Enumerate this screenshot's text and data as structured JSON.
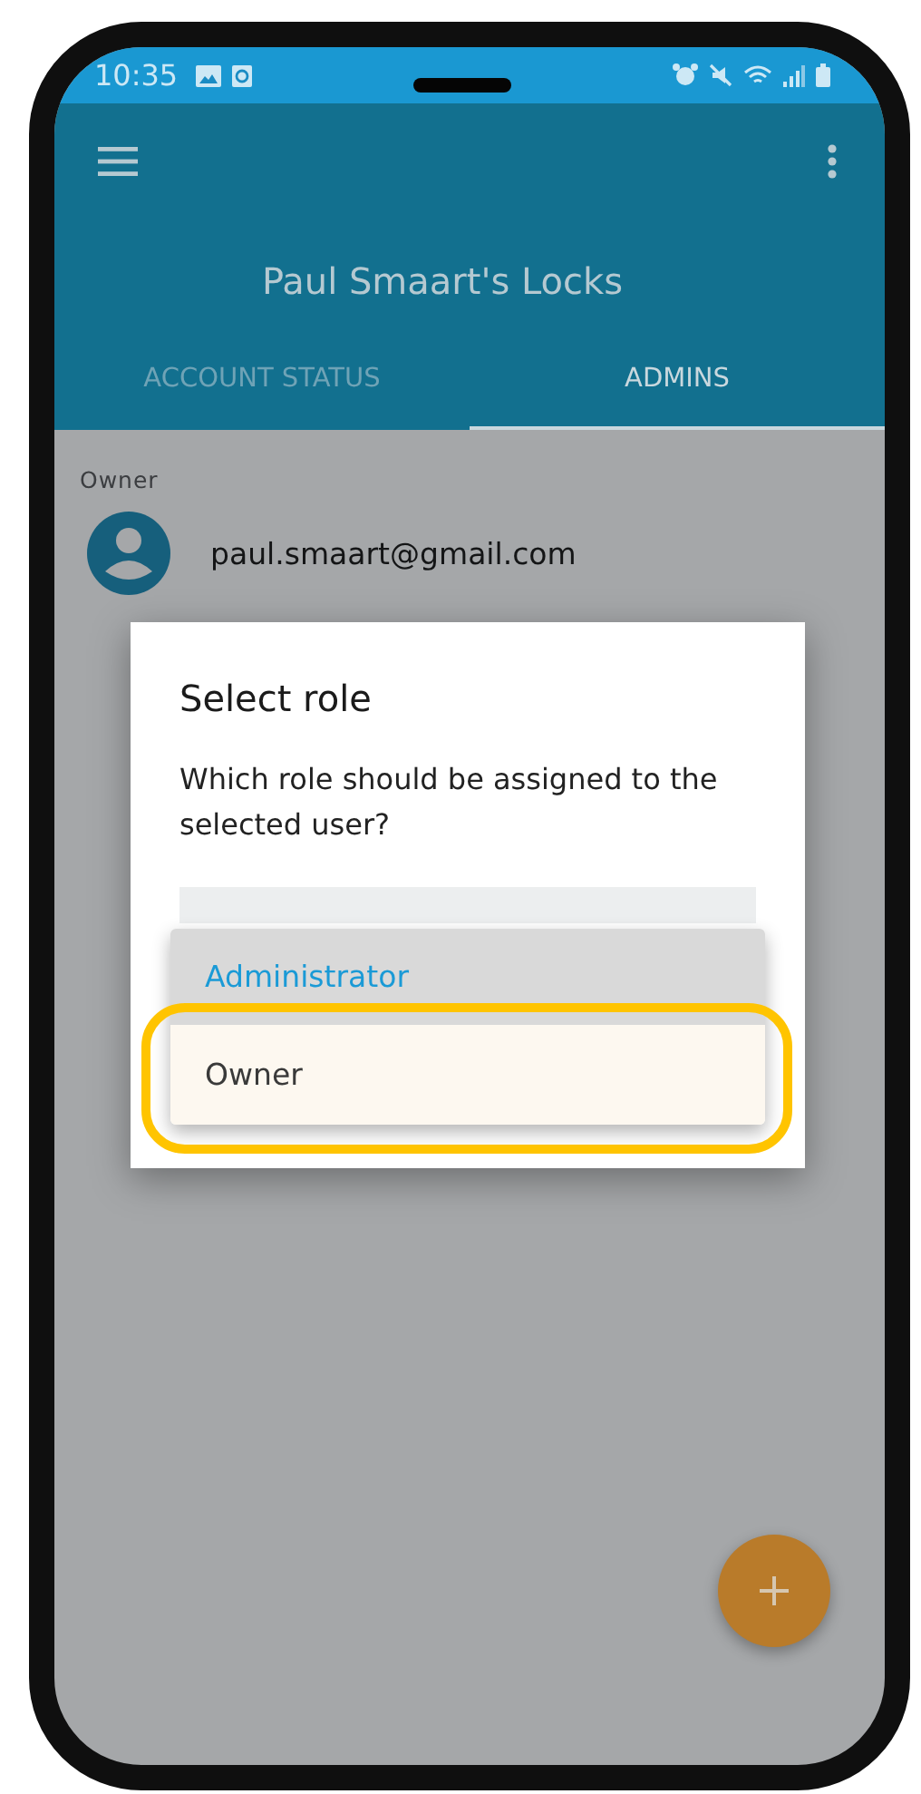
{
  "status_bar": {
    "time": "10:35"
  },
  "app_bar": {
    "title": "Paul Smaart's Locks"
  },
  "tabs": [
    {
      "label": "ACCOUNT STATUS",
      "selected": false
    },
    {
      "label": "ADMINS",
      "selected": true
    }
  ],
  "section": {
    "label": "Owner",
    "email": "paul.smaart@gmail.com"
  },
  "dialog": {
    "title": "Select role",
    "message": "Which role should be assigned to the selected user?",
    "options": [
      {
        "label": "Administrator",
        "selected": true,
        "highlighted": false
      },
      {
        "label": "Owner",
        "selected": false,
        "highlighted": true
      }
    ]
  }
}
